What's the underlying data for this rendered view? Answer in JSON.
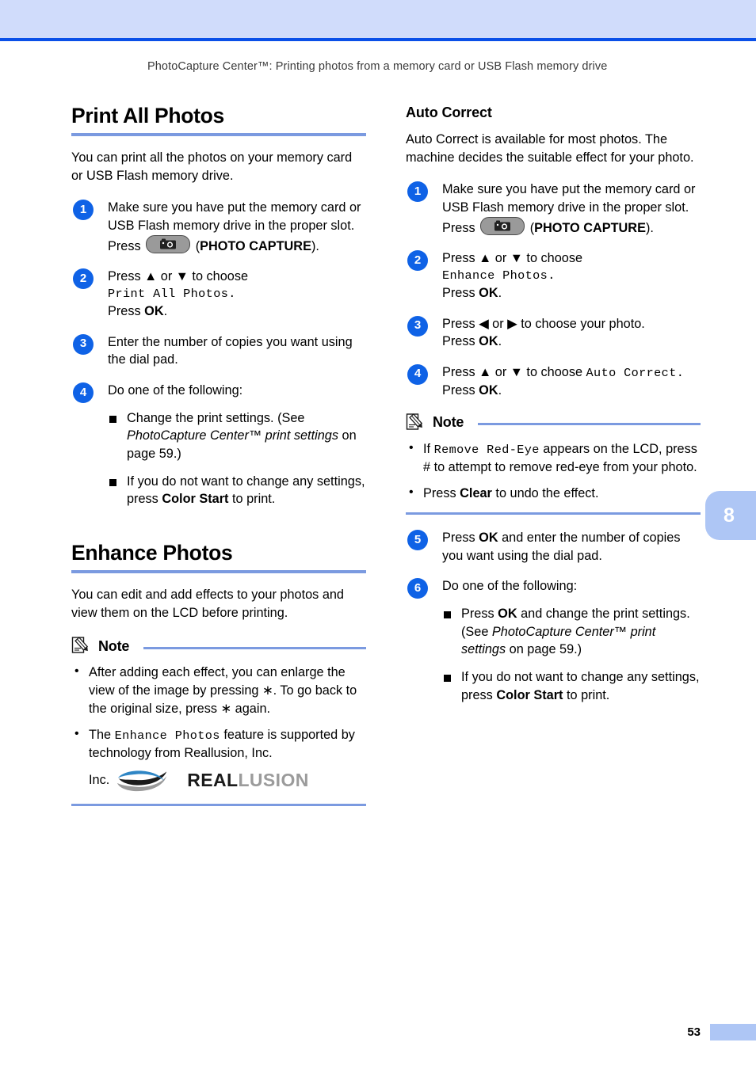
{
  "page": {
    "running_head": "PhotoCapture Center™: Printing photos from a memory card or USB Flash memory drive",
    "chapter_tab": "8",
    "folio": "53",
    "accent_blue": "#0a50e8",
    "rule_blue": "#7b9ae0",
    "tab_blue": "#aec6f5",
    "band_blue": "#d0dcfb"
  },
  "left_column": {
    "heading": "Print All Photos",
    "intro": "You can print all the photos on your memory card or USB Flash memory drive.",
    "steps": [
      {
        "num": "1",
        "line1": "Make sure you have put the memory card or USB Flash memory drive in the proper slot.",
        "press_label": "Press",
        "key_icon": "photo-capture-key-icon",
        "key_name_open": "(",
        "key_name": "PHOTO CAPTURE",
        "key_name_close": ")."
      },
      {
        "num": "2",
        "line1": "Press ▲ or ▼ to choose",
        "lcd": "Print All Photos.",
        "line3_pre": "Press ",
        "line3_bold": "OK",
        "line3_post": "."
      },
      {
        "num": "3",
        "line1": "Enter the number of copies you want using the dial pad."
      },
      {
        "num": "4",
        "line1": "Do one of the following:",
        "bullets": [
          {
            "pre": "Change the print settings. (See ",
            "italic": "PhotoCapture Center™ print settings",
            "post": " on page 59.)"
          },
          {
            "pre": "If you do not want to change any settings, press ",
            "bold": "Color Start",
            "post": " to print."
          }
        ]
      }
    ],
    "heading2": "Enhance Photos",
    "intro2": "You can edit and add effects to your photos and view them on the LCD before printing.",
    "note": {
      "title": "Note",
      "icon": "note-pencil-icon",
      "items": [
        {
          "text": "After adding each effect, you can enlarge the view of the image by pressing ∗. To go back to the original size, press ∗ again."
        },
        {
          "pre": "The ",
          "lcd": "Enhance Photos",
          "post": " feature is supported by technology from Reallusion, Inc."
        }
      ],
      "logo": {
        "inc": "Inc.",
        "swoosh_icon": "reallusion-swoosh-icon",
        "word_part1": "REAL",
        "word_part2": "LUSION"
      }
    }
  },
  "right_column": {
    "heading": "Auto Correct",
    "intro": "Auto Correct is available for most photos. The machine decides the suitable effect for your photo.",
    "steps": [
      {
        "num": "1",
        "line1": "Make sure you have put the memory card or USB Flash memory drive in the proper slot.",
        "press_label": "Press",
        "key_icon": "photo-capture-key-icon",
        "key_name_open": "(",
        "key_name": "PHOTO CAPTURE",
        "key_name_close": ")."
      },
      {
        "num": "2",
        "line1": "Press ▲ or ▼ to choose",
        "lcd": "Enhance Photos.",
        "line3_pre": "Press ",
        "line3_bold": "OK",
        "line3_post": "."
      },
      {
        "num": "3",
        "line1": "Press ◀ or ▶ to choose your photo.",
        "line2_pre": "Press ",
        "line2_bold": "OK",
        "line2_post": "."
      },
      {
        "num": "4",
        "line1_pre": "Press ▲ or ▼ to choose ",
        "lcd": "Auto Correct.",
        "line2_pre": "Press ",
        "line2_bold": "OK",
        "line2_post": "."
      },
      {
        "num": "5",
        "pre": "Press ",
        "bold": "OK",
        "post": " and enter the number of copies you want using the dial pad."
      },
      {
        "num": "6",
        "line1": "Do one of the following:",
        "bullets": [
          {
            "pre": "Press ",
            "bold": "OK",
            "mid": " and change the print settings. (See ",
            "italic": "PhotoCapture Center™ print settings",
            "post": " on page 59.)"
          },
          {
            "pre": "If you do not want to change any settings, press ",
            "bold": "Color Start",
            "post": " to print."
          }
        ]
      }
    ],
    "note": {
      "title": "Note",
      "icon": "note-pencil-icon",
      "items": [
        {
          "pre": "If ",
          "lcd": "Remove Red-Eye",
          "post": " appears on the LCD, press # to attempt to remove red-eye from your photo."
        },
        {
          "pre": "Press ",
          "bold": "Clear",
          "post": " to undo the effect."
        }
      ]
    }
  }
}
